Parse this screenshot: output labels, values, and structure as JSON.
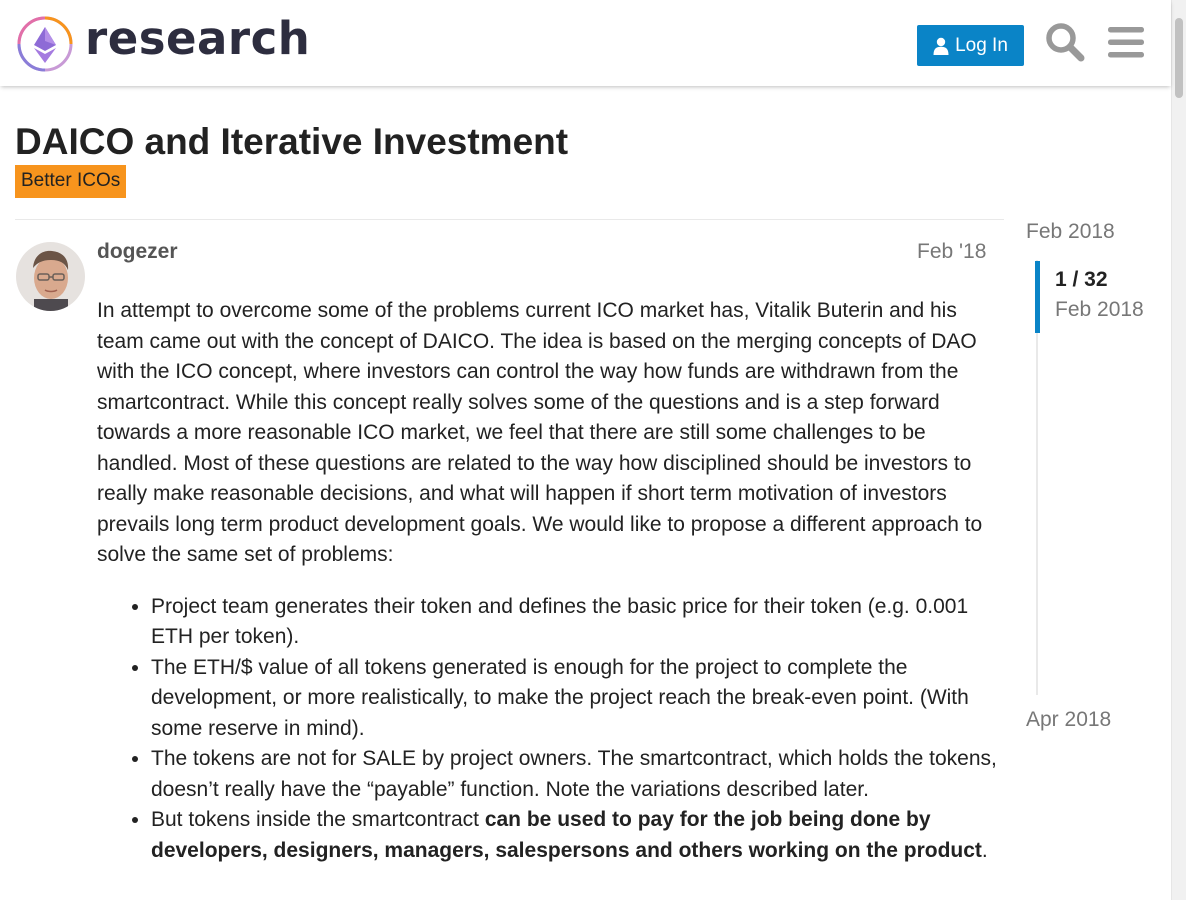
{
  "header": {
    "logo_text": "research",
    "login_label": "Log In",
    "search_icon": "search-icon",
    "menu_icon": "hamburger-menu-icon",
    "accent_color": "#0a84c7"
  },
  "topic": {
    "title": "DAICO and Iterative Investment",
    "category": "Better ICOs",
    "category_color": "#f7941d"
  },
  "post": {
    "username": "dogezer",
    "date": "Feb '18",
    "paragraph": "In attempt to overcome some of the problems current ICO market has, Vitalik Buterin and his team came out with the concept of DAICO. The idea is based on the merging concepts of DAO with the ICO concept, where investors can control the way how funds are withdrawn from the smartcontract. While this concept really solves some of the questions and is a step forward towards a more reasonable ICO market, we feel that there are still some challenges to be handled. Most of these questions are related to the way how disciplined should be investors to really make reasonable decisions, and what will happen if short term motivation of investors prevails long term product development goals. We would like to propose a different approach to solve the same set of problems:",
    "bullets": [
      "Project team generates their token and defines the basic price for their token (e.g. 0.001 ETH per token).",
      "The ETH/$ value of all tokens generated is enough for the project to complete the development, or more realistically, to make the project reach the break-even point. (With some reserve in mind).",
      "The tokens are not for SALE by project owners. The smartcontract, which holds the tokens, doesn’t really have the “payable” function. Note the variations described later."
    ],
    "bullet4_prefix": "But tokens inside the smartcontract ",
    "bullet4_bold": "can be used to pay for the job being done by developers, designers, managers, salespersons and others working on the product",
    "bullet4_suffix": "."
  },
  "timeline": {
    "start_label": "Feb 2018",
    "position": "1 / 32",
    "current_date": "Feb 2018",
    "end_label": "Apr 2018",
    "progress_fraction": 0.03125
  }
}
